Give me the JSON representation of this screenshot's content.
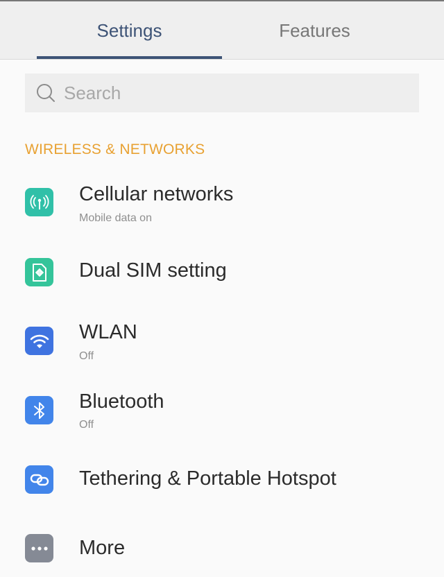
{
  "tabs": [
    {
      "label": "Settings",
      "active": true
    },
    {
      "label": "Features",
      "active": false
    }
  ],
  "search": {
    "placeholder": "Search",
    "value": ""
  },
  "section": {
    "title": "WIRELESS & NETWORKS"
  },
  "items": [
    {
      "icon": "cellular-antenna-icon",
      "title": "Cellular networks",
      "subtitle": "Mobile data on",
      "color": "#30c0a8"
    },
    {
      "icon": "sim-card-icon",
      "title": "Dual SIM setting",
      "subtitle": "",
      "color": "#34c49a"
    },
    {
      "icon": "wifi-icon",
      "title": "WLAN",
      "subtitle": "Off",
      "color": "#3f73e0"
    },
    {
      "icon": "bluetooth-icon",
      "title": "Bluetooth",
      "subtitle": "Off",
      "color": "#4285ea"
    },
    {
      "icon": "link-icon",
      "title": "Tethering & Portable Hotspot",
      "subtitle": "",
      "color": "#4285ea"
    },
    {
      "icon": "more-dots-icon",
      "title": "More",
      "subtitle": "",
      "color": "#858a95"
    }
  ],
  "colors": {
    "accent": "#3d5376",
    "section": "#e8a132"
  }
}
